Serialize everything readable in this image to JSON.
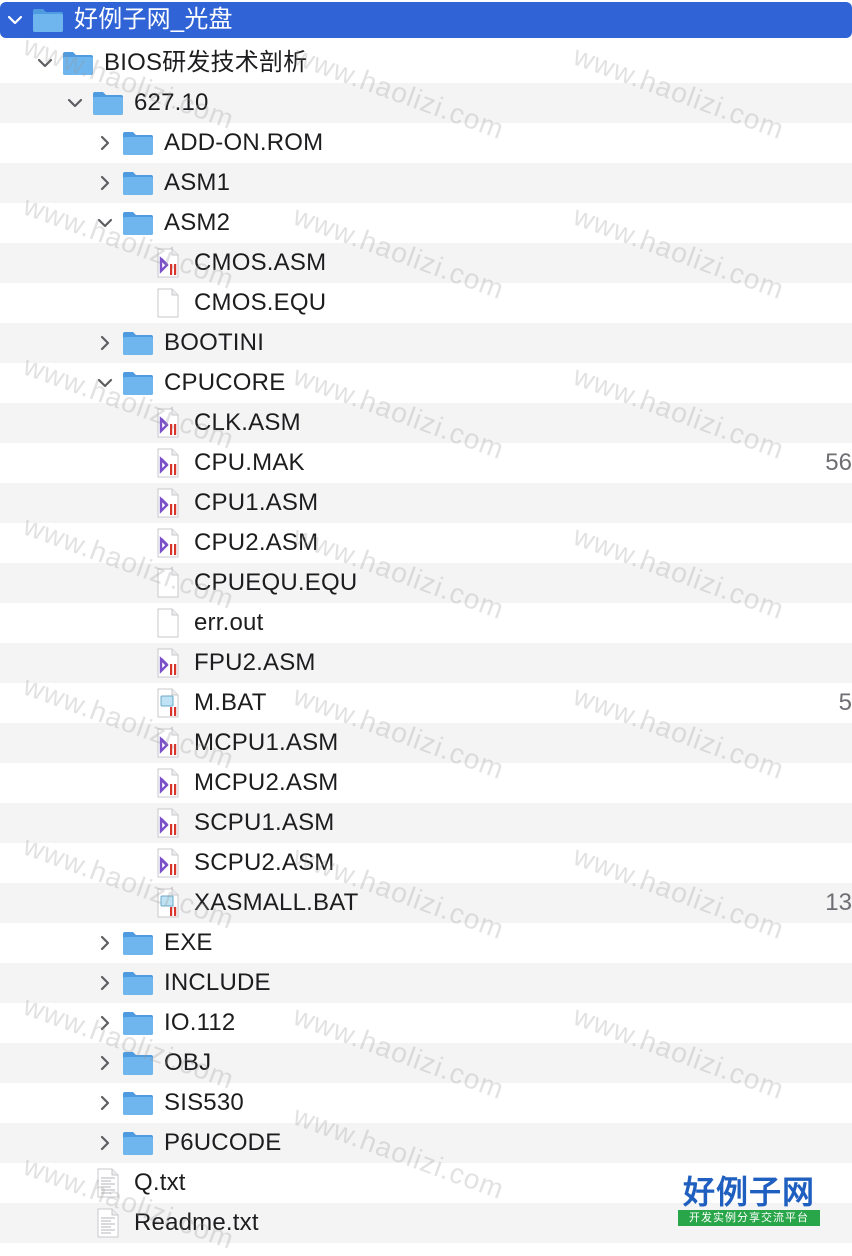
{
  "colors": {
    "selection": "#2f63d6",
    "stripe": "#f4f4f5",
    "folder": "#6fb6ee",
    "folder_dark": "#4e9be0",
    "asm_icon_purple": "#7b4fc9",
    "asm_icon_red": "#d8342c"
  },
  "tree": [
    {
      "label": "好例子网_光盘",
      "level": 0,
      "kind": "folder",
      "chevron": "down",
      "selected": true
    },
    {
      "label": "BIOS研发技术剖析",
      "level": 1,
      "kind": "folder",
      "chevron": "down"
    },
    {
      "label": "627.10",
      "level": 2,
      "kind": "folder",
      "chevron": "down"
    },
    {
      "label": "ADD-ON.ROM",
      "level": 3,
      "kind": "folder",
      "chevron": "right"
    },
    {
      "label": "ASM1",
      "level": 3,
      "kind": "folder",
      "chevron": "right"
    },
    {
      "label": "ASM2",
      "level": 3,
      "kind": "folder",
      "chevron": "down"
    },
    {
      "label": "CMOS.ASM",
      "level": 4,
      "kind": "asm-file"
    },
    {
      "label": "CMOS.EQU",
      "level": 4,
      "kind": "blank-file"
    },
    {
      "label": "BOOTINI",
      "level": 3,
      "kind": "folder",
      "chevron": "right"
    },
    {
      "label": "CPUCORE",
      "level": 3,
      "kind": "folder",
      "chevron": "down"
    },
    {
      "label": "CLK.ASM",
      "level": 4,
      "kind": "asm-file"
    },
    {
      "label": "CPU.MAK",
      "level": 4,
      "kind": "asm-file",
      "size": "56"
    },
    {
      "label": "CPU1.ASM",
      "level": 4,
      "kind": "asm-file"
    },
    {
      "label": "CPU2.ASM",
      "level": 4,
      "kind": "asm-file"
    },
    {
      "label": "CPUEQU.EQU",
      "level": 4,
      "kind": "blank-file"
    },
    {
      "label": "err.out",
      "level": 4,
      "kind": "blank-file"
    },
    {
      "label": "FPU2.ASM",
      "level": 4,
      "kind": "asm-file"
    },
    {
      "label": "M.BAT",
      "level": 4,
      "kind": "bat-file",
      "size": "5"
    },
    {
      "label": "MCPU1.ASM",
      "level": 4,
      "kind": "asm-file"
    },
    {
      "label": "MCPU2.ASM",
      "level": 4,
      "kind": "asm-file"
    },
    {
      "label": "SCPU1.ASM",
      "level": 4,
      "kind": "asm-file"
    },
    {
      "label": "SCPU2.ASM",
      "level": 4,
      "kind": "asm-file"
    },
    {
      "label": "XASMALL.BAT",
      "level": 4,
      "kind": "bat-file",
      "size": "13"
    },
    {
      "label": "EXE",
      "level": 3,
      "kind": "folder",
      "chevron": "right"
    },
    {
      "label": "INCLUDE",
      "level": 3,
      "kind": "folder",
      "chevron": "right"
    },
    {
      "label": "IO.112",
      "level": 3,
      "kind": "folder",
      "chevron": "right"
    },
    {
      "label": "OBJ",
      "level": 3,
      "kind": "folder",
      "chevron": "right"
    },
    {
      "label": "SIS530",
      "level": 3,
      "kind": "folder",
      "chevron": "right"
    },
    {
      "label": "P6UCODE",
      "level": 3,
      "kind": "folder",
      "chevron": "right"
    },
    {
      "label": "Q.txt",
      "level": 2,
      "kind": "text-file"
    },
    {
      "label": "Readme.txt",
      "level": 2,
      "kind": "text-file"
    }
  ],
  "watermark": {
    "text": "www.haolizi.com"
  },
  "logo": {
    "brand": "好例子网",
    "tagline": "开发实例分享交流平台"
  }
}
